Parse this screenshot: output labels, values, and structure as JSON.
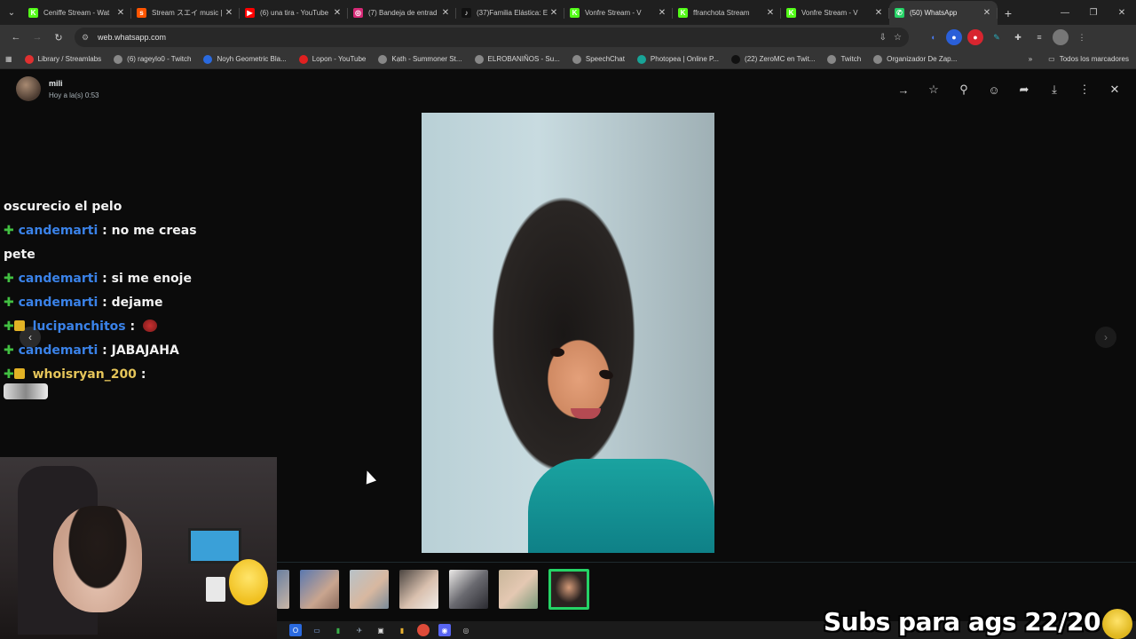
{
  "browser": {
    "tabs": [
      {
        "title": "Ceniffe Stream - Wat",
        "fav_color": "#53fc18",
        "fav_glyph": "K"
      },
      {
        "title": "Stream スエイ music |",
        "fav_color": "#ff5500",
        "fav_glyph": "s"
      },
      {
        "title": "(6) una tira - YouTube",
        "fav_color": "#ff0000",
        "fav_glyph": "▶"
      },
      {
        "title": "(7) Bandeja de entrad",
        "fav_color": "#d62976",
        "fav_glyph": "◎"
      },
      {
        "title": "(37)Familia Elástica: E",
        "fav_color": "#111111",
        "fav_glyph": "♪"
      },
      {
        "title": "Vonfre Stream - V",
        "fav_color": "#53fc18",
        "fav_glyph": "K"
      },
      {
        "title": "ffranchota Stream",
        "fav_color": "#53fc18",
        "fav_glyph": "K"
      },
      {
        "title": "Vonfre Stream - V",
        "fav_color": "#53fc18",
        "fav_glyph": "K"
      },
      {
        "title": "(50) WhatsApp",
        "fav_color": "#25d366",
        "fav_glyph": "✆",
        "active": true
      }
    ],
    "url": "web.whatsapp.com",
    "bookmarks": [
      {
        "label": "Library / Streamlabs",
        "color": "#e03030"
      },
      {
        "label": "(6) rageylo0 - Twitch",
        "color": "#888888"
      },
      {
        "label": "Noyh Geometric Bla...",
        "color": "#2a6adf"
      },
      {
        "label": "Lopon - YouTube",
        "color": "#e02020"
      },
      {
        "label": "Kạth - Summoner St...",
        "color": "#888888"
      },
      {
        "label": "ELROBANIÑOS - Su...",
        "color": "#888888"
      },
      {
        "label": "SpeechChat",
        "color": "#888888"
      },
      {
        "label": "Photopea | Online P...",
        "color": "#18a497"
      },
      {
        "label": "(22) ZeroMC en Twit...",
        "color": "#111111"
      },
      {
        "label": "Twitch",
        "color": "#888888"
      },
      {
        "label": "Organizador De Zap...",
        "color": "#888888"
      }
    ],
    "bookmarks_all": "Todos los marcadores"
  },
  "viewer": {
    "sender_name": "mili",
    "timestamp": "Hoy a la(s) 0:53"
  },
  "chat": {
    "first_line": "oscurecio el pelo",
    "messages": [
      {
        "user": "candemarti",
        "text": ": no me creas",
        "crown": false
      },
      {
        "continuation": "pete"
      },
      {
        "user": "candemarti",
        "text": ": si me enoje",
        "crown": false
      },
      {
        "user": "candemarti",
        "text": ": dejame",
        "crown": false
      },
      {
        "user": "lucipanchitos",
        "text": ":",
        "crown": true,
        "emote": true
      },
      {
        "user": "candemarti",
        "text": ": JABAJAHA",
        "crown": false
      },
      {
        "user": "whoisryan_200",
        "text": ":",
        "crown": true,
        "gold": true
      }
    ]
  },
  "overlay": {
    "subs_text": "Subs para ags 22/20"
  }
}
